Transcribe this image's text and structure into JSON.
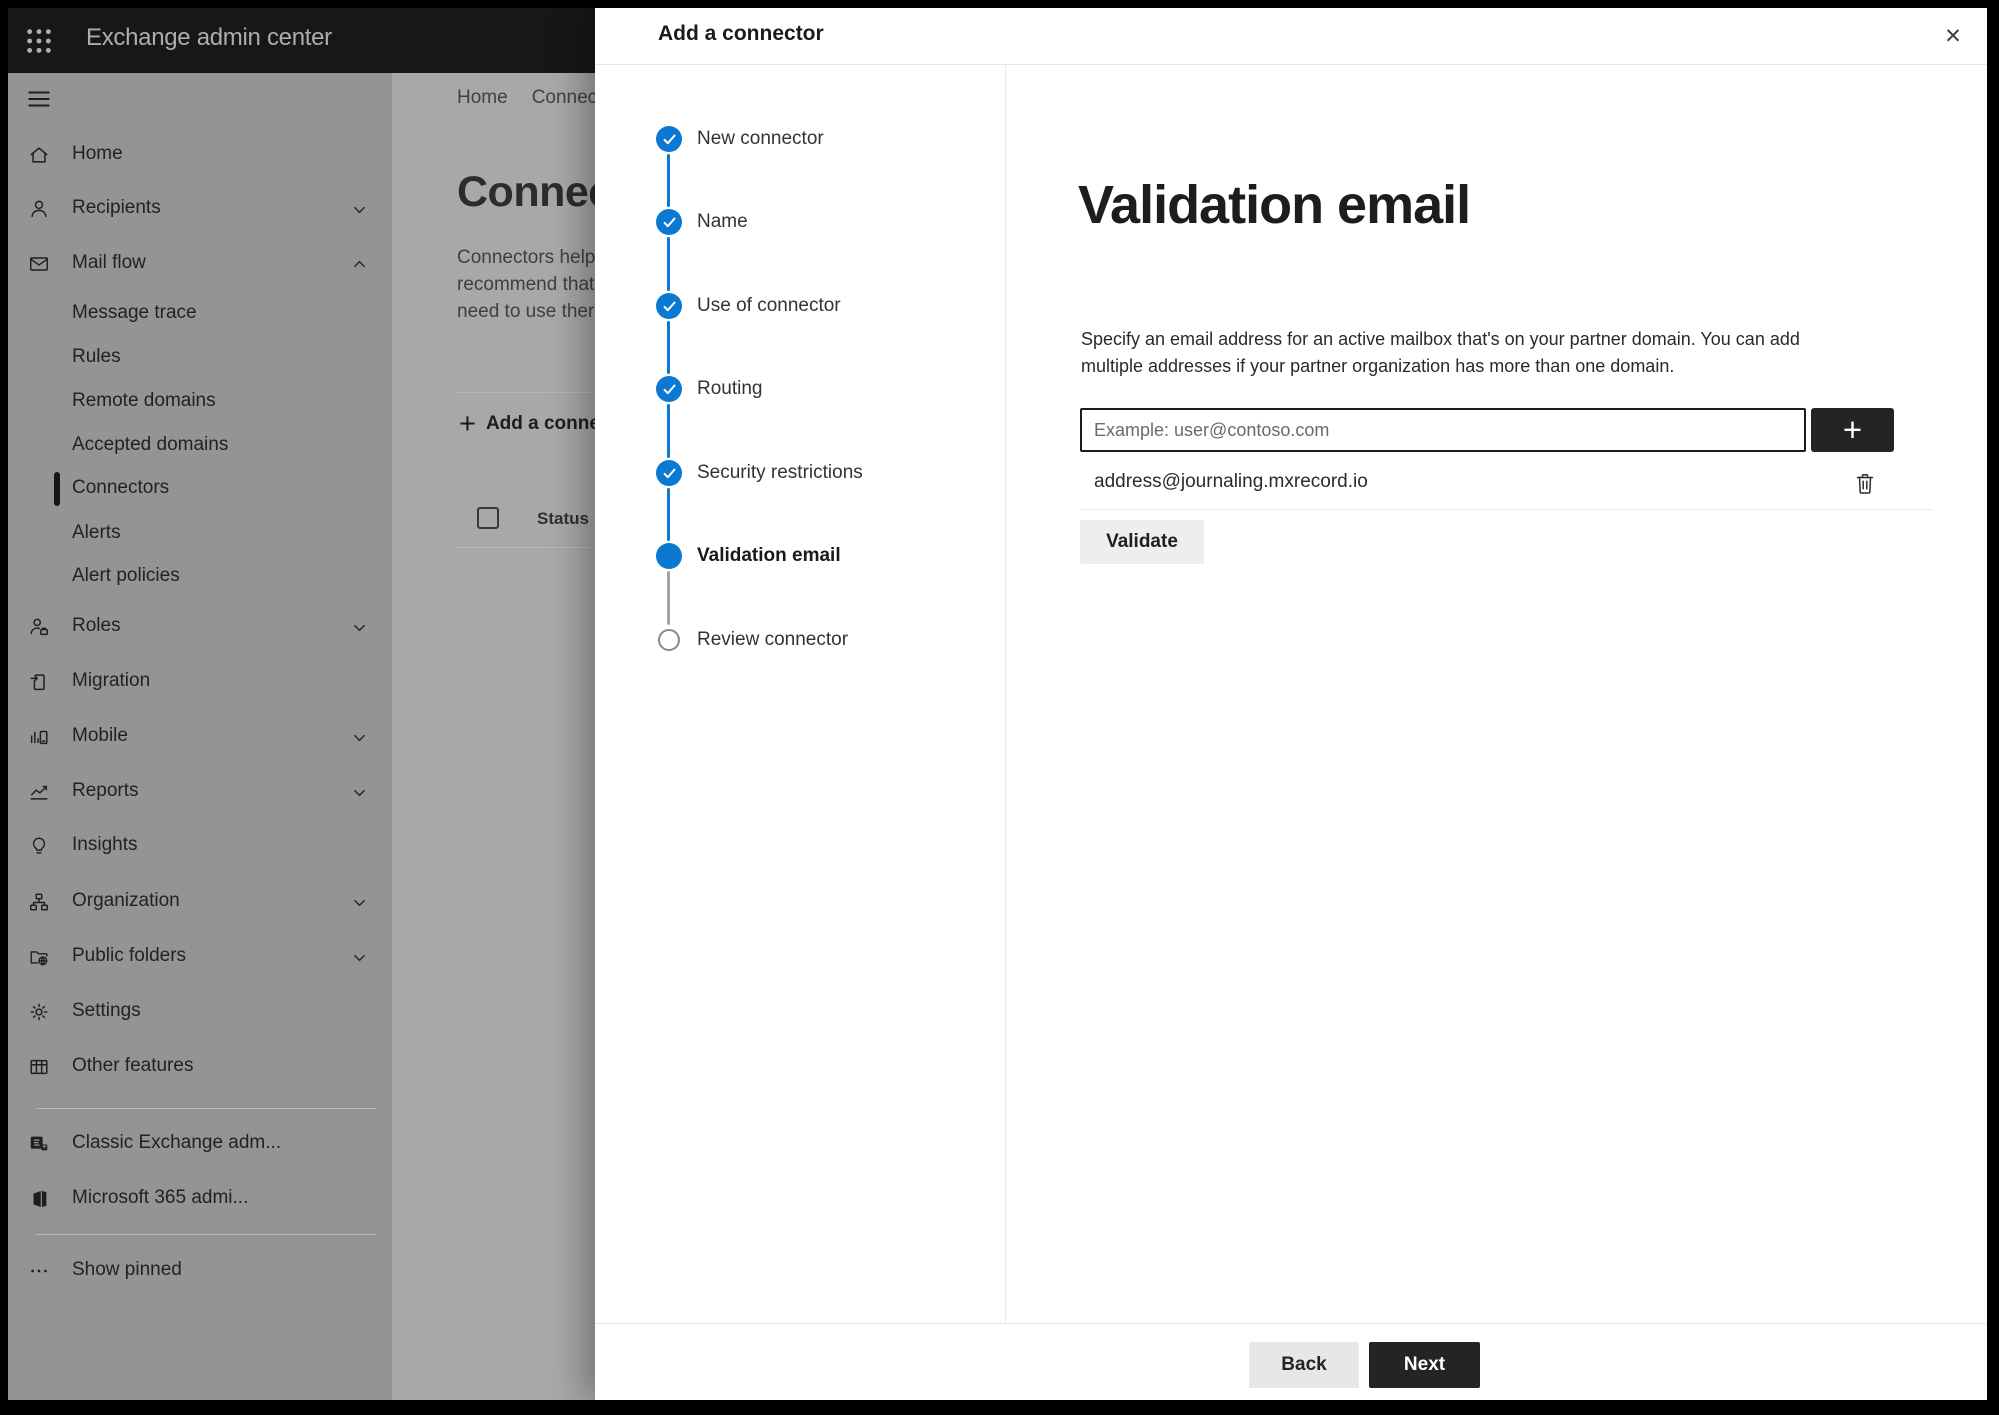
{
  "topbar": {
    "app_title": "Exchange admin center"
  },
  "breadcrumb": {
    "items": [
      "Home",
      "Connectors"
    ]
  },
  "page_background": {
    "title": "Connectors",
    "description_lines": [
      "Connectors help",
      "recommend that",
      "need to use ther"
    ],
    "add_button_label": "Add a connector",
    "status_column_label": "Status"
  },
  "sidebar": {
    "items": [
      {
        "label": "Home",
        "icon": "home"
      },
      {
        "label": "Recipients",
        "icon": "person",
        "chevron": "down"
      },
      {
        "label": "Mail flow",
        "icon": "mail",
        "chevron": "up",
        "expanded": true
      },
      {
        "label": "Message trace",
        "child": true
      },
      {
        "label": "Rules",
        "child": true
      },
      {
        "label": "Remote domains",
        "child": true
      },
      {
        "label": "Accepted domains",
        "child": true
      },
      {
        "label": "Connectors",
        "child": true,
        "selected": true
      },
      {
        "label": "Alerts",
        "child": true
      },
      {
        "label": "Alert policies",
        "child": true
      },
      {
        "label": "Roles",
        "icon": "person-badge",
        "chevron": "down"
      },
      {
        "label": "Migration",
        "icon": "document-import"
      },
      {
        "label": "Mobile",
        "icon": "mobile-device",
        "chevron": "down"
      },
      {
        "label": "Reports",
        "icon": "line-chart",
        "chevron": "down"
      },
      {
        "label": "Insights",
        "icon": "lightbulb"
      },
      {
        "label": "Organization",
        "icon": "org-chart",
        "chevron": "down"
      },
      {
        "label": "Public folders",
        "icon": "folder-globe",
        "chevron": "down"
      },
      {
        "label": "Settings",
        "icon": "gear"
      },
      {
        "label": "Other features",
        "icon": "table-grid"
      },
      {
        "label": "Classic Exchange adm...",
        "icon": "exchange-logo"
      },
      {
        "label": "Microsoft 365 admi...",
        "icon": "microsoft-365-logo"
      },
      {
        "label": "Show pinned",
        "icon": "ellipsis"
      }
    ]
  },
  "dialog": {
    "title": "Add a connector",
    "steps": [
      {
        "label": "New connector",
        "state": "completed"
      },
      {
        "label": "Name",
        "state": "completed"
      },
      {
        "label": "Use of connector",
        "state": "completed"
      },
      {
        "label": "Routing",
        "state": "completed"
      },
      {
        "label": "Security restrictions",
        "state": "completed"
      },
      {
        "label": "Validation email",
        "state": "current"
      },
      {
        "label": "Review connector",
        "state": "upcoming"
      }
    ],
    "content": {
      "heading": "Validation email",
      "description_lines": [
        "Specify an email address for an active mailbox that's on your partner domain. You can add",
        "multiple addresses if your partner organization has more than one domain."
      ],
      "email_input": {
        "value": "",
        "placeholder": "Example: user@contoso.com"
      },
      "addresses": [
        "address@journaling.mxrecord.io"
      ],
      "validate_button_label": "Validate"
    },
    "footer": {
      "back_label": "Back",
      "next_label": "Next"
    }
  },
  "icons": {
    "close": "✕",
    "add_plus": "+",
    "breadcrumb_separator": "›",
    "show_pinned_ellipsis": "···"
  },
  "colors": {
    "accent_blue": "#0b79d1",
    "dark_button": "#242424",
    "step_pending_gray": "#8a8886"
  }
}
